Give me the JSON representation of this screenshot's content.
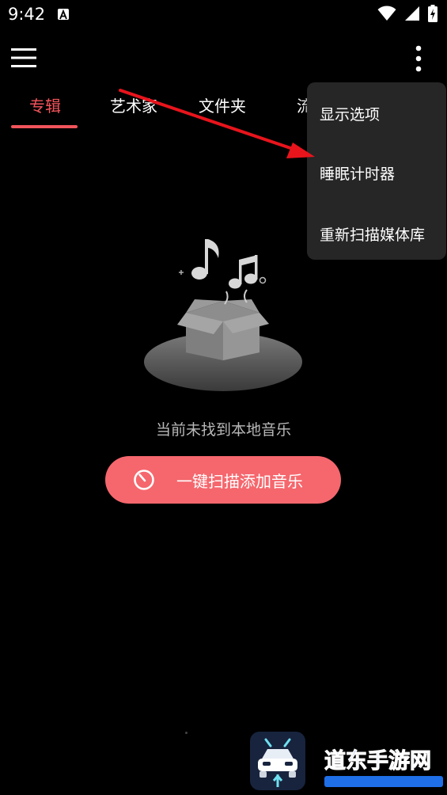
{
  "status_bar": {
    "time": "9:42",
    "icons": [
      "notification-a-icon",
      "wifi-icon",
      "cell-signal-icon",
      "battery-icon"
    ]
  },
  "tabs": [
    {
      "label": "专辑",
      "active": true
    },
    {
      "label": "艺术家",
      "active": false
    },
    {
      "label": "文件夹",
      "active": false
    },
    {
      "label": "流",
      "active": false
    }
  ],
  "empty_state": {
    "message": "当前未找到本地音乐",
    "scan_button_label": "一键扫描添加音乐"
  },
  "popup_menu": {
    "items": [
      "显示选项",
      "睡眠计时器",
      "重新扫描媒体库"
    ]
  },
  "watermark": {
    "text": "道东手游网"
  },
  "colors": {
    "accent": "#f2545b",
    "button": "#f5676d",
    "popup_bg": "#262626",
    "background": "#000000",
    "arrow": "#e8141c"
  }
}
